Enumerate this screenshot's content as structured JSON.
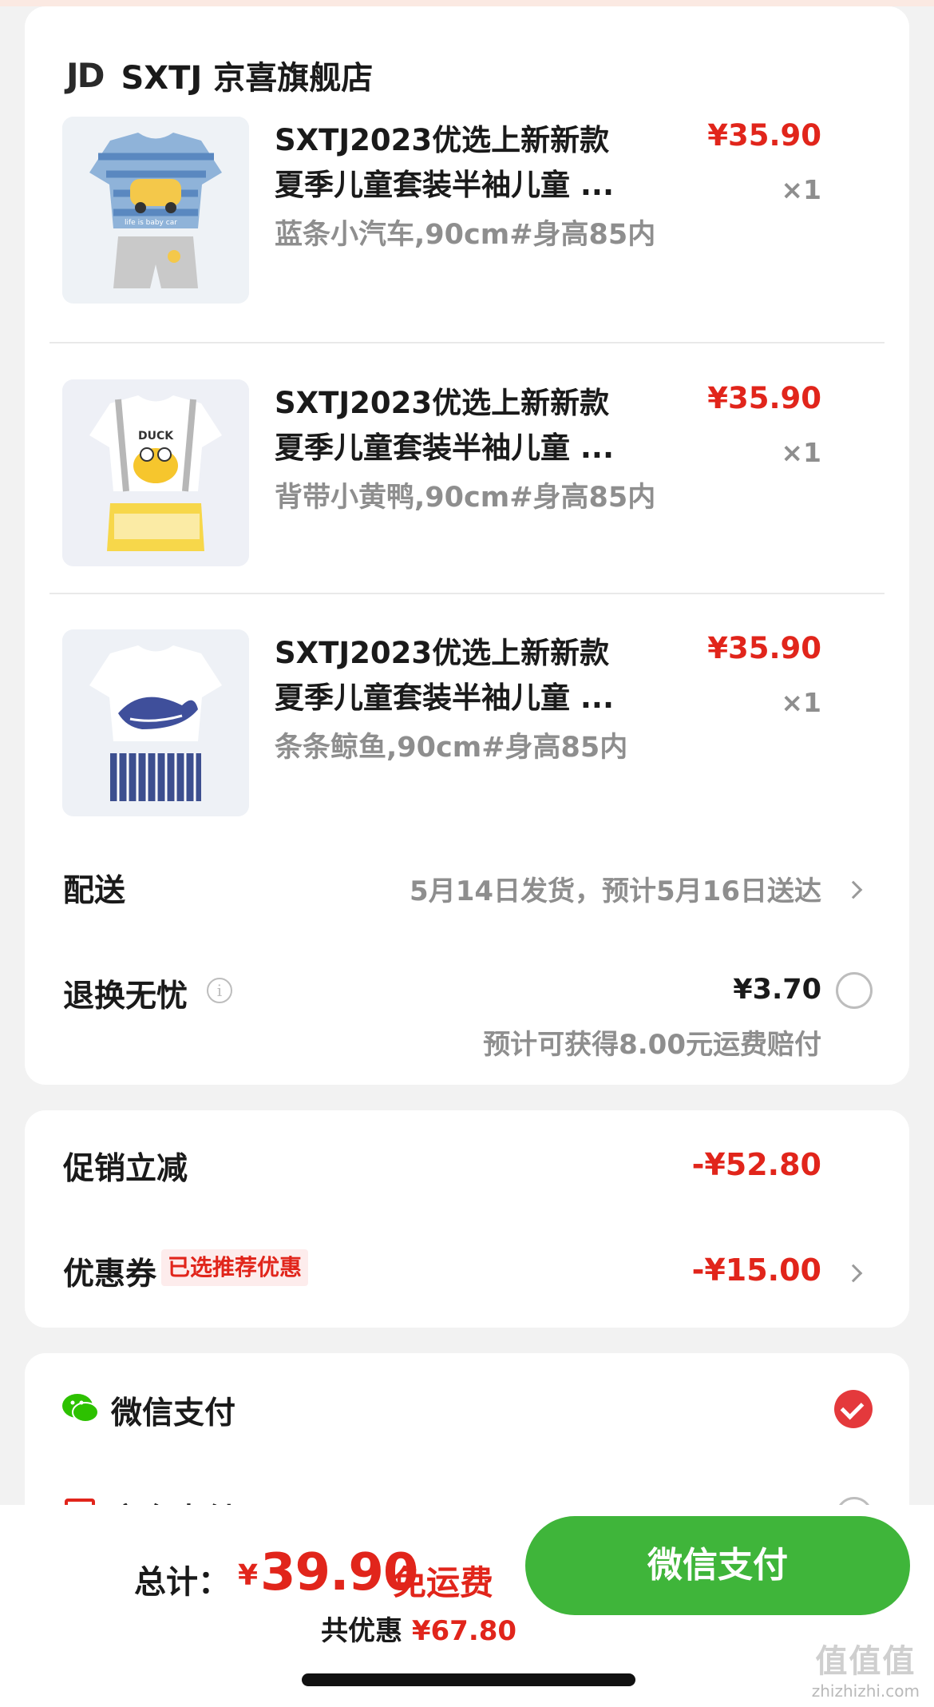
{
  "shop": {
    "logo": "JD",
    "name": "SXTJ 京喜旗舰店"
  },
  "products": [
    {
      "title_line1": "SXTJ2023优选上新新款",
      "title_line2": "夏季儿童套装半袖儿童 ...",
      "spec": "蓝条小汽车,90cm#身高85内",
      "price": "¥35.90",
      "qty": "×1",
      "image_label": "life is baby car"
    },
    {
      "title_line1": "SXTJ2023优选上新新款",
      "title_line2": "夏季儿童套装半袖儿童 ...",
      "spec": "背带小黄鸭,90cm#身高85内",
      "price": "¥35.90",
      "qty": "×1",
      "image_label": "DUCK"
    },
    {
      "title_line1": "SXTJ2023优选上新新款",
      "title_line2": "夏季儿童套装半袖儿童 ...",
      "spec": "条条鲸鱼,90cm#身高85内",
      "price": "¥35.90",
      "qty": "×1",
      "image_label": ""
    }
  ],
  "delivery": {
    "label": "配送",
    "value": "5月14日发货，预计5月16日送达"
  },
  "return_insurance": {
    "label": "退换无忧",
    "info_icon": "i",
    "price": "¥3.70",
    "note": "预计可获得8.00元运费赔付"
  },
  "promo": {
    "label": "促销立减",
    "amount": "-¥52.80"
  },
  "coupon": {
    "label": "优惠券",
    "tag": "已选推荐优惠",
    "amount": "-¥15.00"
  },
  "payment": {
    "wechat_label": "微信支付",
    "jd_label": "京东支付"
  },
  "bottom": {
    "total_label": "总计：",
    "currency": "¥",
    "total_amount": "39.90",
    "free_shipping": "免运费",
    "discount_label": "共优惠",
    "discount_amount": "¥67.80",
    "pay_button": "微信支付"
  },
  "watermark": {
    "text": "值值值",
    "url": "zhizhizhi.com"
  },
  "colors": {
    "accent_red": "#e1251b",
    "wechat_green": "#3fb53a",
    "gray_text": "#8e8e8e",
    "background": "#f2f2f2"
  }
}
